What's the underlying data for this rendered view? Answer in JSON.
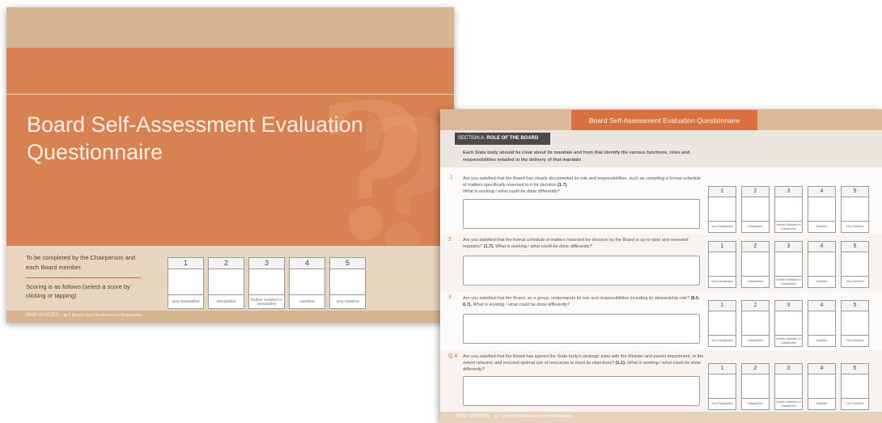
{
  "cover": {
    "title": "Board Self-Assessment Evaluation Questionnaire",
    "intro": "To be completed by the Chairperson and each Board member.",
    "scoring": "Scoring is as follows (select a score by clicking or tapping)",
    "footer_brand": "ONE⁷GUIDES",
    "footer_sub": "■ 1 Board Self-Assessment Evaluation"
  },
  "scale": [
    {
      "num": "1",
      "label": "Very Dissatisfied"
    },
    {
      "num": "2",
      "label": "Dissatisfied"
    },
    {
      "num": "3",
      "label": "Neither Satisfied or Dissatisfied"
    },
    {
      "num": "4",
      "label": "Satisfied"
    },
    {
      "num": "5",
      "label": "Very Satisfied"
    }
  ],
  "questionnaire": {
    "header_title": "Board Self-Assessment Evaluation Questionnaire",
    "section_prefix": "SECTION A: ",
    "section_name": "ROLE OF THE BOARD",
    "section_intro": "Each State body should be clear about its mandate and from that identify the various functions, roles and responsibilities entailed in the delivery of that mandate",
    "prompt": "What is working / what could be done differently?",
    "questions": [
      {
        "num": ".1",
        "text": "Are you satisfied that the Board has clearly documented its role and responsibilities, such as compiling a formal schedule of matters specifically reserved to it for decision",
        "ref": "(1.7)."
      },
      {
        "num": "2",
        "text": "Are you satisfied that the formal schedule of matters reserved for decision by the Board is up-to-date and reviewed regularly?",
        "ref": "(1.7)."
      },
      {
        "num": "3",
        "text": "Are you satisfied that the Board, as a group, understands its role and responsibilities including its stewardship role?",
        "ref": "(8.5-8.7)."
      },
      {
        "num": "Q.4",
        "text": "Are you satisfied that the Board has agreed the State body's strategic aims with the Minister and parent department, to the extent relevant, and ensured optimal use of resources to meet its objectives?",
        "ref": "(1.1)."
      }
    ],
    "footer_brand": "ONE⁷GUIDES",
    "footer_sub": "■ 1 Board Self-Assessment Evaluation"
  }
}
